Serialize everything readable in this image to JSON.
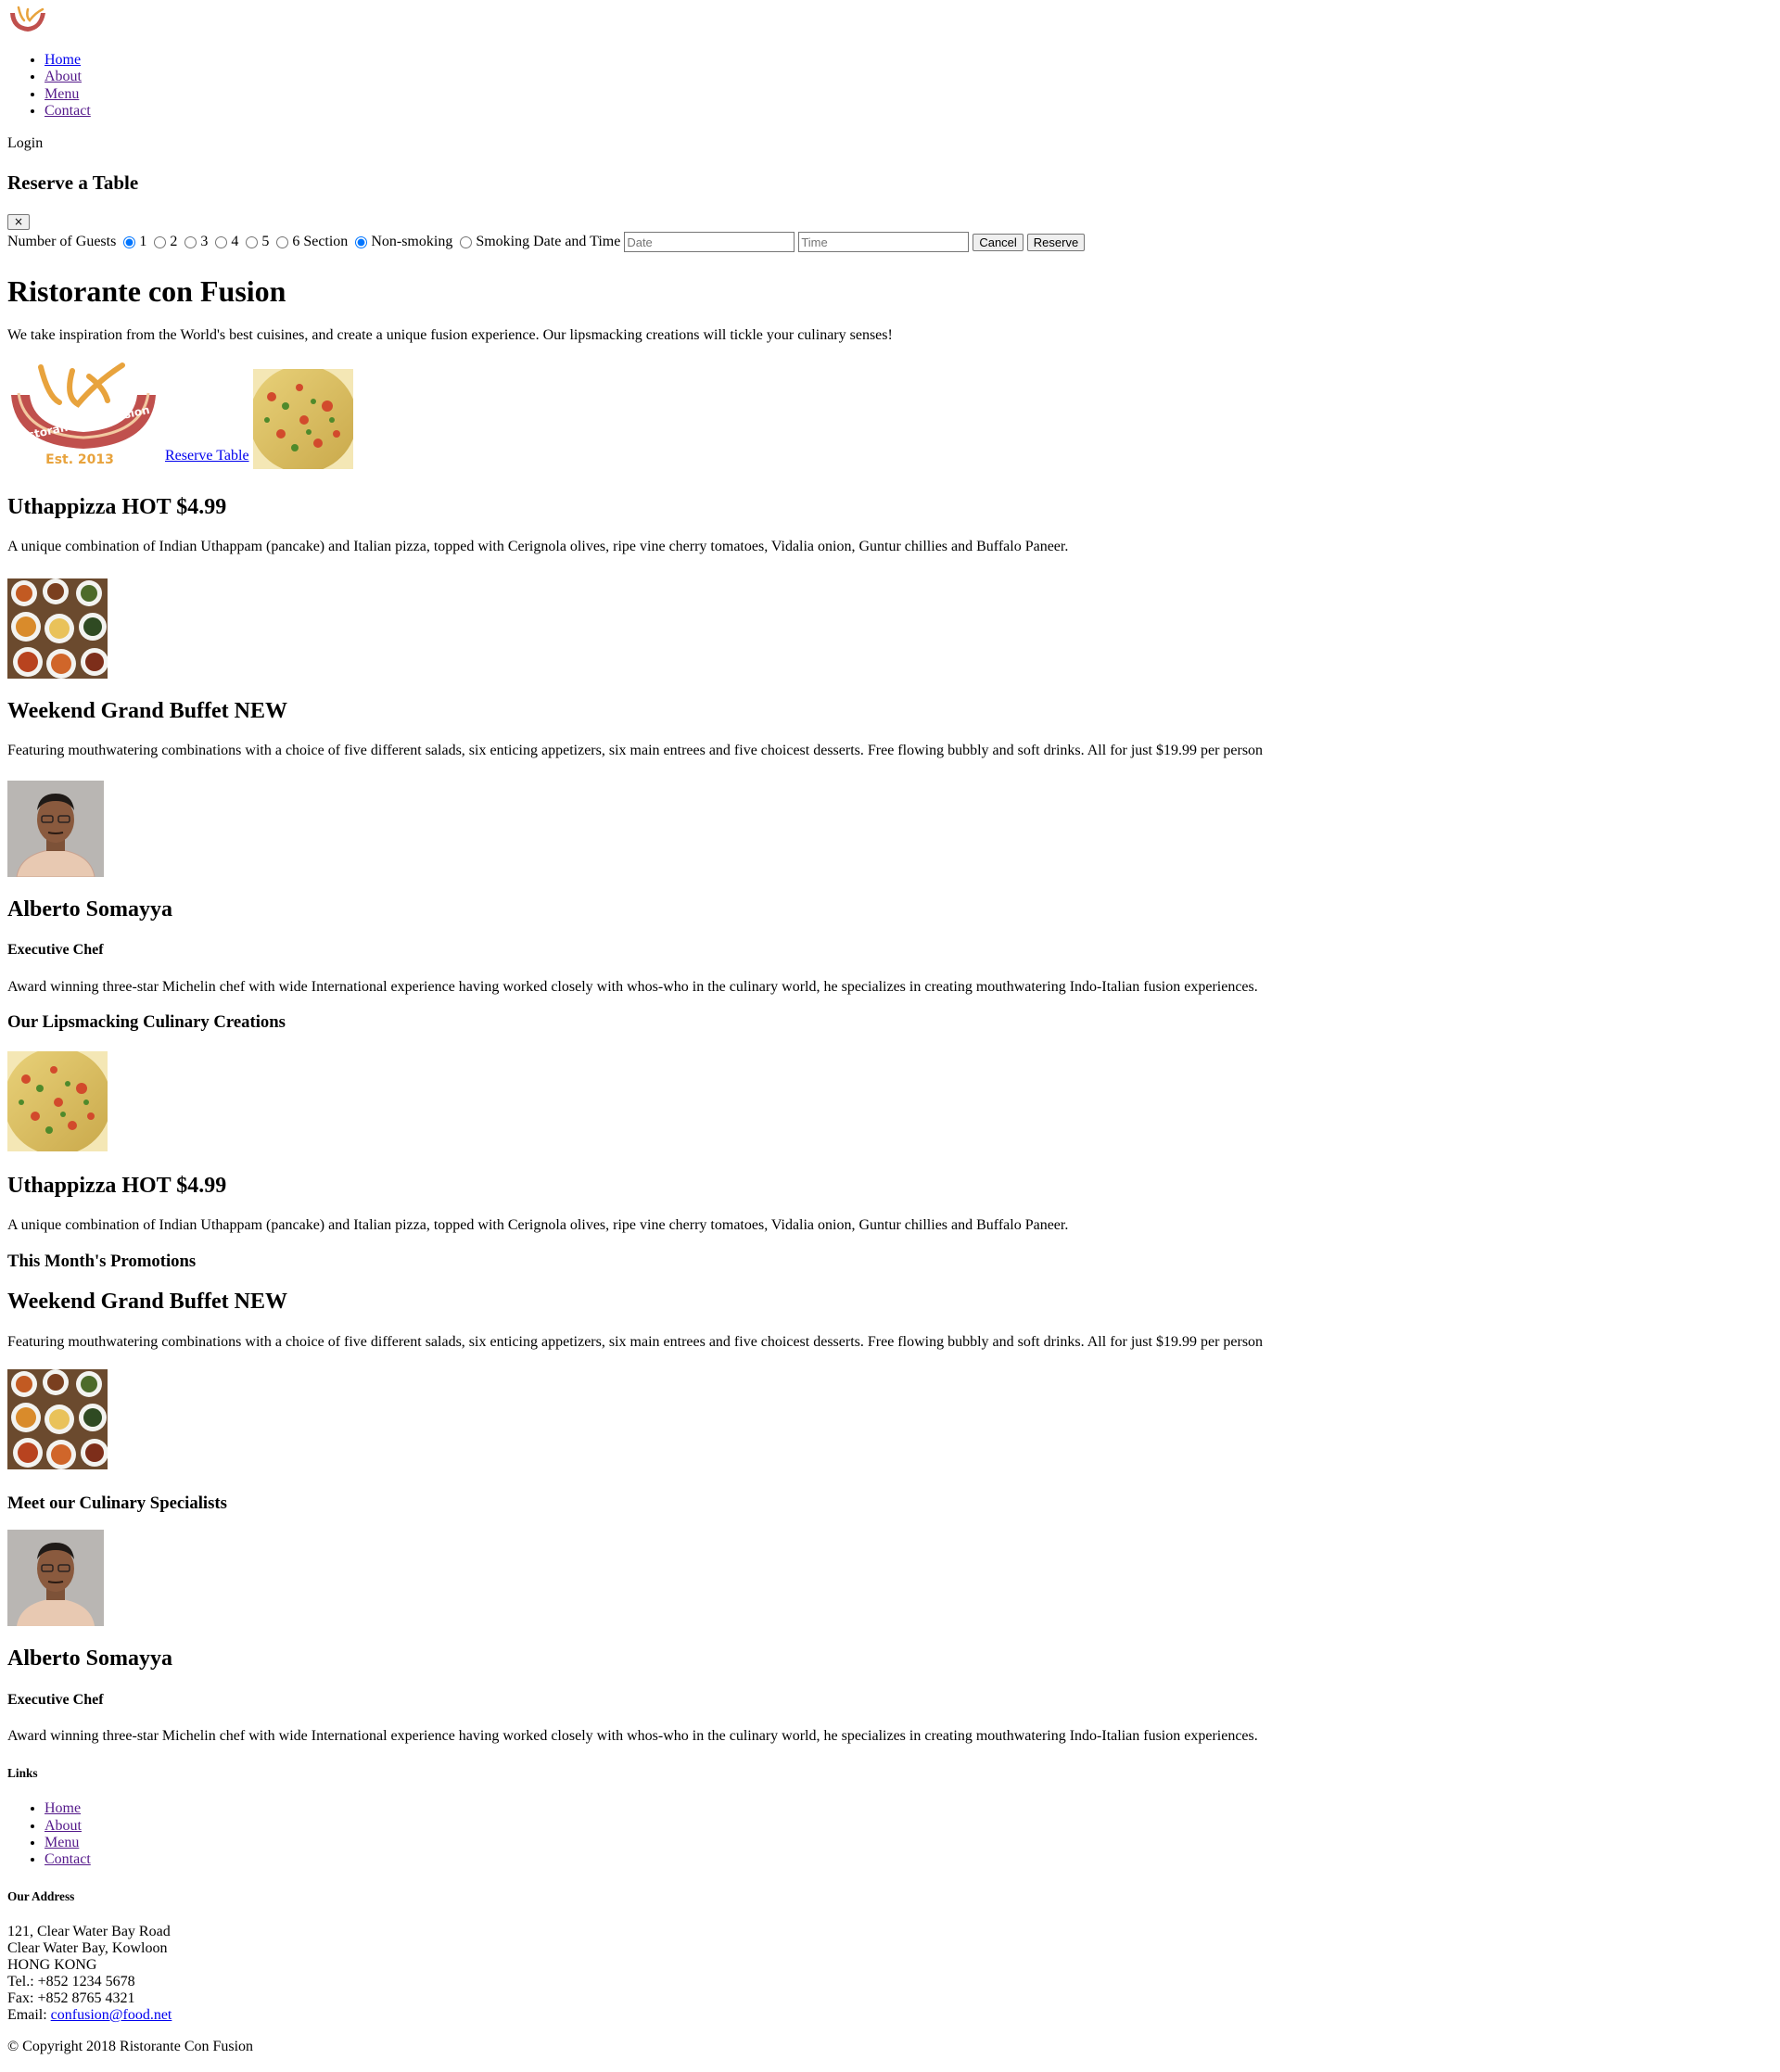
{
  "nav": {
    "logo_icon": "restaurant-logo-icon",
    "links": [
      "Home",
      "About",
      "Menu",
      "Contact"
    ],
    "login": "Login"
  },
  "reserve_modal": {
    "title": "Reserve a Table",
    "close": "×",
    "guests_label": "Number of Guests",
    "guest_options": [
      "1",
      "2",
      "3",
      "4",
      "5",
      "6"
    ],
    "guest_selected": "1",
    "section_label": "Section",
    "section_options": [
      "Non-smoking",
      "Smoking"
    ],
    "section_selected": "Non-smoking",
    "datetime_label": "Date and Time",
    "date_placeholder": "Date",
    "time_placeholder": "Time",
    "cancel": "Cancel",
    "reserve": "Reserve"
  },
  "jumbotron": {
    "title": "Ristorante con Fusion",
    "description": "We take inspiration from the World's best cuisines, and create a unique fusion experience. Our lipsmacking creations will tickle your culinary senses!",
    "logo_text": "Ristorante con Fusion",
    "logo_est": "Est. 2013",
    "reserve_link": "Reserve Table"
  },
  "featured": {
    "dish": {
      "title": "Uthappizza HOT $4.99",
      "description": "A unique combination of Indian Uthappam (pancake) and Italian pizza, topped with Cerignola olives, ripe vine cherry tomatoes, Vidalia onion, Guntur chillies and Buffalo Paneer."
    },
    "promo": {
      "title": "Weekend Grand Buffet NEW",
      "description": "Featuring mouthwatering combinations with a choice of five different salads, six enticing appetizers, six main entrees and five choicest desserts. Free flowing bubbly and soft drinks. All for just $19.99 per person"
    },
    "leader": {
      "name": "Alberto Somayya",
      "designation": "Executive Chef",
      "description": "Award winning three-star Michelin chef with wide International experience having worked closely with whos-who in the culinary world, he specializes in creating mouthwatering Indo-Italian fusion experiences."
    }
  },
  "sections": {
    "creations": "Our Lipsmacking Culinary Creations",
    "promotions": "This Month's Promotions",
    "specialists": "Meet our Culinary Specialists"
  },
  "footer": {
    "links_heading": "Links",
    "links": [
      "Home",
      "About",
      "Menu",
      "Contact"
    ],
    "address_heading": "Our Address",
    "address_lines": [
      "121, Clear Water Bay Road",
      "Clear Water Bay, Kowloon",
      "HONG KONG"
    ],
    "tel": "Tel.: +852 1234 5678",
    "fax": "Fax: +852 8765 4321",
    "email_label": "Email:",
    "email": "confusion@food.net",
    "copyright": "© Copyright 2018 Ristorante Con Fusion"
  },
  "colors": {
    "link": "#0000ee",
    "visited_link": "#551a8b",
    "logo_red": "#c0504d",
    "logo_orange": "#e8a33d"
  }
}
